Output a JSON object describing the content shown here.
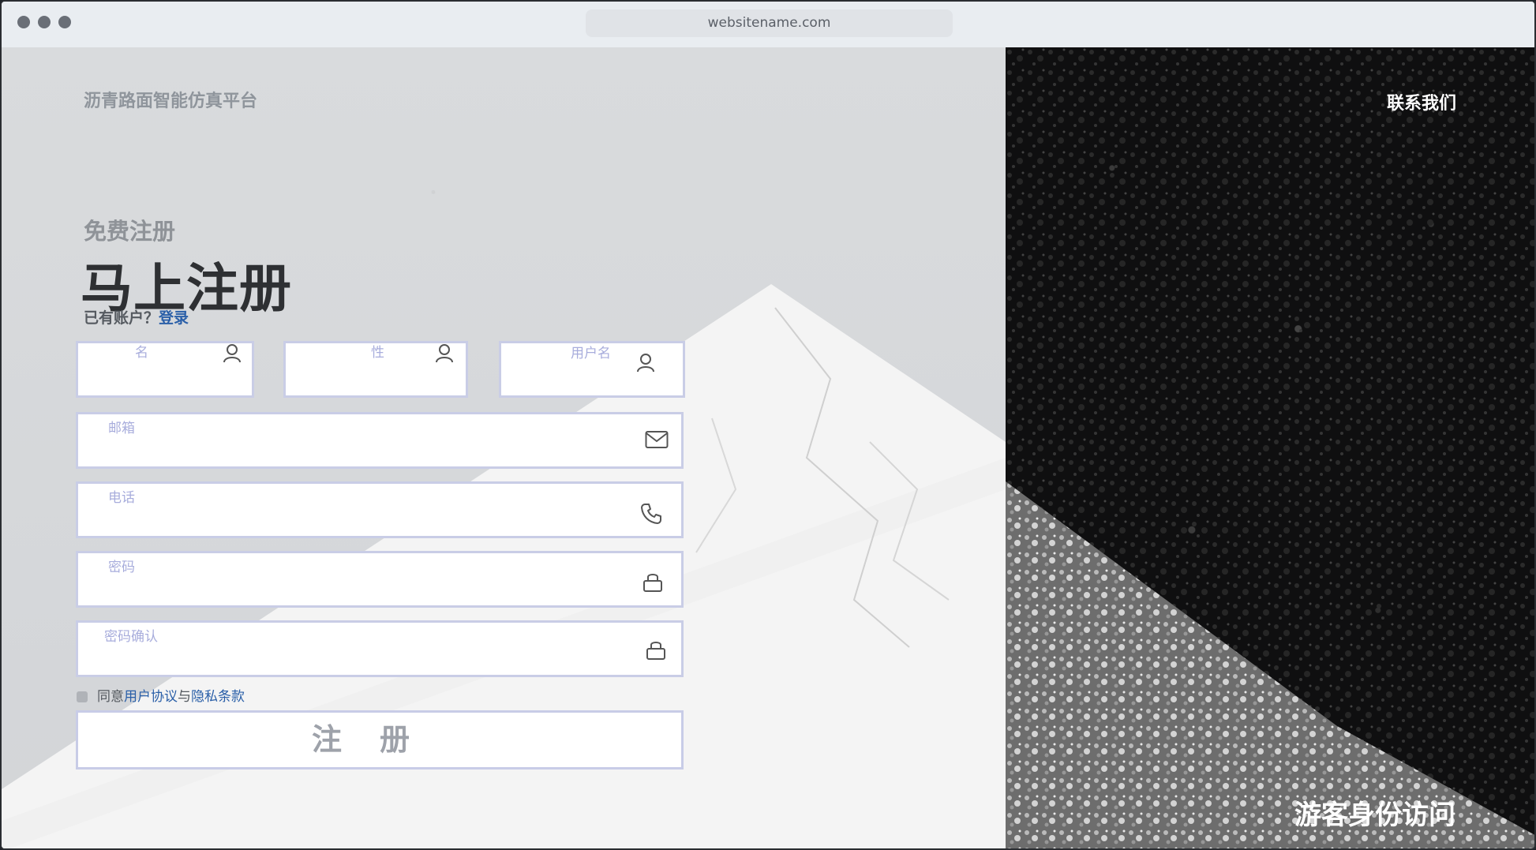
{
  "browser": {
    "url": "websitename.com"
  },
  "header": {
    "brand": "沥青路面智能仿真平台",
    "contact": "联系我们"
  },
  "form": {
    "subtitle": "免费注册",
    "title": "马上注册",
    "have_account": "已有账户？",
    "login_link": "登录",
    "fields": {
      "first_name": {
        "label": "名"
      },
      "last_name": {
        "label": "性"
      },
      "username": {
        "label": "用户名"
      },
      "email": {
        "label": "邮箱"
      },
      "phone": {
        "label": "电话"
      },
      "password": {
        "label": "密码"
      },
      "password_confirm": {
        "label": "密码确认"
      }
    },
    "agree": {
      "prefix": "同意",
      "terms": "用户协议",
      "and": "与",
      "privacy": "隐私条款",
      "checked": false
    },
    "submit": "注册"
  },
  "guest_access": "游客身份访问",
  "icons": [
    "user-icon",
    "mail-icon",
    "phone-icon",
    "lock-icon"
  ]
}
